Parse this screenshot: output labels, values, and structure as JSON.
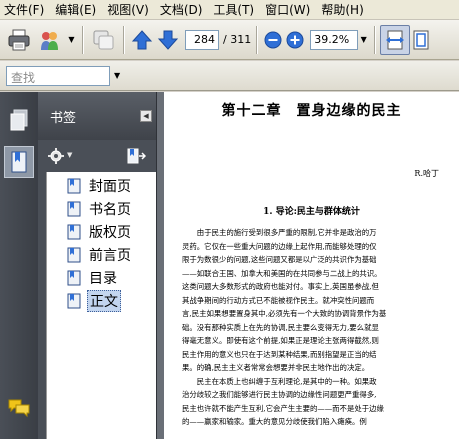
{
  "menu": [
    "文件(F)",
    "编辑(E)",
    "视图(V)",
    "文档(D)",
    "工具(T)",
    "窗口(W)",
    "帮助(H)"
  ],
  "toolbar": {
    "page_current": "284",
    "page_total": "/ 311",
    "zoom": "39.2%",
    "icons": [
      "print-icon",
      "share-icon",
      "comment-icon",
      "page-up-icon",
      "page-down-icon",
      "zoom-out-icon",
      "zoom-in-icon",
      "fit-width-icon",
      "fit-page-icon"
    ]
  },
  "find": {
    "placeholder": "查找"
  },
  "sidebar": {
    "title": "书签",
    "items": [
      {
        "label": "封面页",
        "selected": false
      },
      {
        "label": "书名页",
        "selected": false
      },
      {
        "label": "版权页",
        "selected": false
      },
      {
        "label": "前言页",
        "selected": false
      },
      {
        "label": "目录",
        "selected": false
      },
      {
        "label": "正文",
        "selected": true
      }
    ]
  },
  "document": {
    "chapter_title": "第十二章　置身边缘的民主",
    "author": "R.哈丁",
    "section_title": "1. 导论:民主与群体统计",
    "lines": [
      "由于民主的施行受到很多严重的限制,它并非是政治的万",
      "灵药。它仅在一些重大问题的边缘上起作用,而能够处理的仅",
      "限于为数很少的问题,这些问题又都是以广泛的共识作为基础",
      "——如联合王国、加拿大和美国的在共同参与二战上的共识。",
      "这类问题大多数形式的政府也能对付。事实上,英国虽参战,但",
      "其战争期间的行动方式已不能被视作民主。就冲突性问题而",
      "言,民主如果想要置身其中,必须先有一个大致的协调背景作为基",
      "础。没有那种实质上在先的协调,民主要么变得无力,要么就显",
      "得毫无意义。即使有这个前提,如果正是理论主张两得截然,则",
      "民主作用的意义也只在于达到某种结果,而别指望是正当的结",
      "果。的确,民主主义者常常会想要并非民主地作出的决定。",
      "民主在本质上也纠缠于互利理论,是其中的一种。如果政",
      "治分歧较之我们能够进行民主协调的边缘性问题更严重得多,",
      "民主也许就不能产生互利,它会产生主要的——而不是处于边缘",
      "的——赢家和输家。重大的意见分歧使我们陷入瘫痪。例"
    ]
  },
  "colors": {
    "sidebar_dark": "#4a4f57",
    "selection": "#c3d5ef",
    "toolbar_blue": "#2f6fd6"
  }
}
